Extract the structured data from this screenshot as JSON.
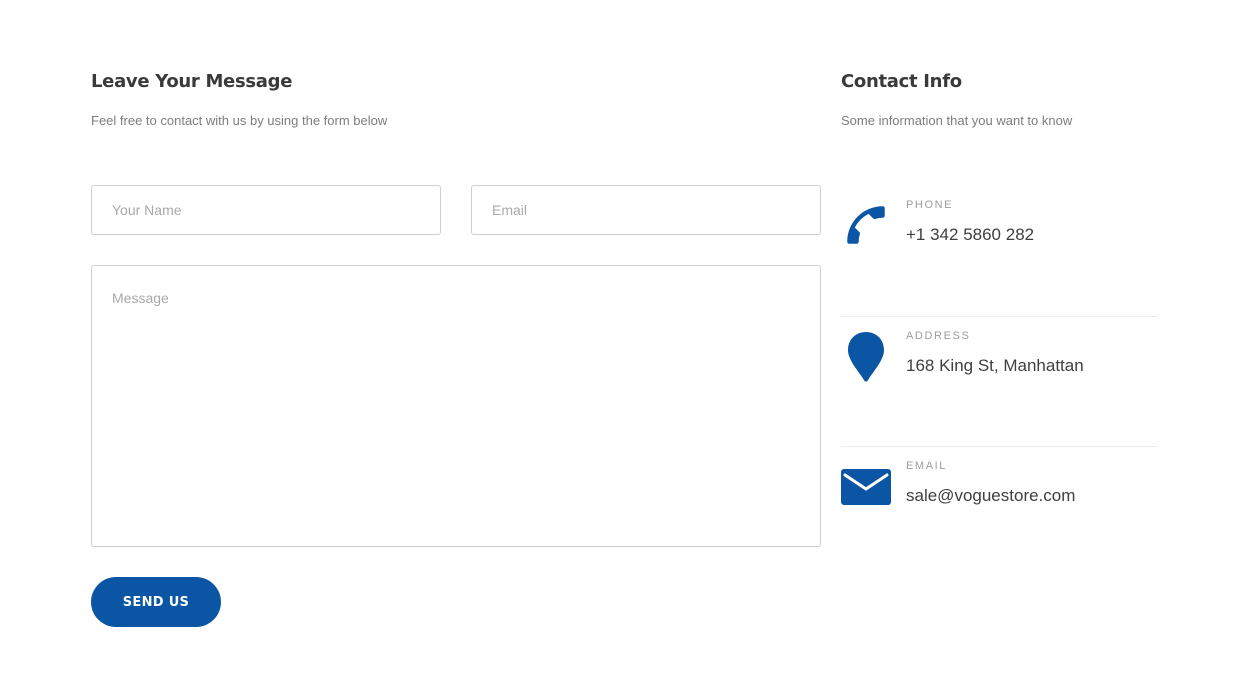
{
  "form": {
    "title": "Leave Your Message",
    "subtitle": "Feel free to contact with us by using the form below",
    "name_placeholder": "Your Name",
    "email_placeholder": "Email",
    "message_placeholder": "Message",
    "submit_label": "SEND US"
  },
  "contact": {
    "title": "Contact Info",
    "subtitle": "Some information that you want to know",
    "items": [
      {
        "icon": "phone-icon",
        "label": "PHONE",
        "value": "+1 342 5860 282"
      },
      {
        "icon": "map-pin-icon",
        "label": "ADDRESS",
        "value": "168 King St, Manhattan"
      },
      {
        "icon": "envelope-icon",
        "label": "EMAIL",
        "value": "sale@voguestore.com"
      }
    ]
  },
  "colors": {
    "accent": "#0a56a5",
    "heading": "#3a3a3a",
    "muted": "#7d7d7d",
    "border": "#cfcfcf",
    "divider": "#ececec"
  }
}
